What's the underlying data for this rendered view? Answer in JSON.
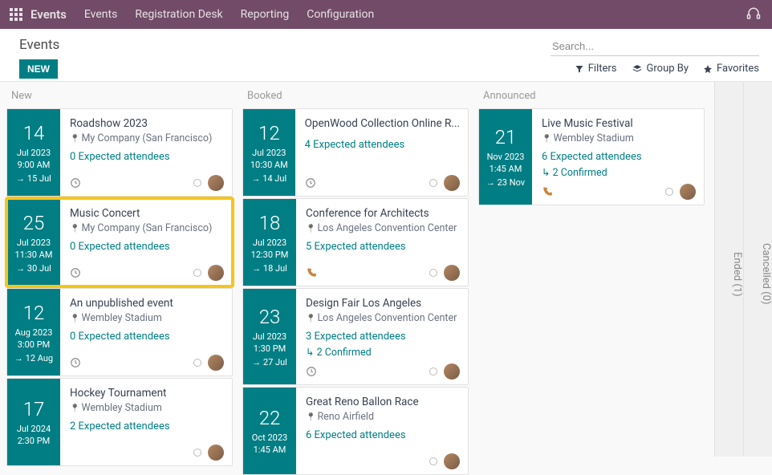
{
  "topbar": {
    "brand": "Events",
    "menu": [
      "Events",
      "Registration Desk",
      "Reporting",
      "Configuration"
    ]
  },
  "page": {
    "title": "Events",
    "new_btn": "NEW",
    "search_placeholder": "Search..."
  },
  "toolbar": {
    "filters": "Filters",
    "groupby": "Group By",
    "favorites": "Favorites"
  },
  "lanes": [
    {
      "name": "New",
      "cards": [
        {
          "day": "14",
          "mon": "Jul 2023",
          "time": "9:00 AM",
          "end": "15 Jul",
          "title": "Roadshow 2023",
          "loc": "My Company (San Francisco)",
          "attendees": "0 Expected attendees",
          "foot_icon": "clock"
        },
        {
          "day": "25",
          "mon": "Jul 2023",
          "time": "11:30 AM",
          "end": "30 Jul",
          "title": "Music Concert",
          "loc": "My Company (San Francisco)",
          "attendees": "0 Expected attendees",
          "foot_icon": "clock",
          "selected": true
        },
        {
          "day": "12",
          "mon": "Aug 2023",
          "time": "3:00 PM",
          "end": "12 Aug",
          "title": "An unpublished event",
          "loc": "Wembley Stadium",
          "attendees": "0 Expected attendees",
          "foot_icon": "clock"
        },
        {
          "day": "17",
          "mon": "Jul 2024",
          "time": "2:30 PM",
          "end": "",
          "title": "Hockey Tournament",
          "loc": "Wembley Stadium",
          "attendees": "2 Expected attendees",
          "foot_icon": ""
        }
      ]
    },
    {
      "name": "Booked",
      "cards": [
        {
          "day": "12",
          "mon": "Jul 2023",
          "time": "10:30 AM",
          "end": "14 Jul",
          "title": "OpenWood Collection Online R...",
          "loc": "",
          "attendees": "4 Expected attendees",
          "foot_icon": "clock"
        },
        {
          "day": "18",
          "mon": "Jul 2023",
          "time": "12:30 PM",
          "end": "18 Jul",
          "title": "Conference for Architects",
          "loc": "Los Angeles Convention Center",
          "attendees": "5 Expected attendees",
          "foot_icon": "phone"
        },
        {
          "day": "23",
          "mon": "Jul 2023",
          "time": "1:30 PM",
          "end": "27 Jul",
          "title": "Design Fair Los Angeles",
          "loc": "Los Angeles Convention Center",
          "attendees": "3 Expected attendees",
          "confirmed": "2 Confirmed",
          "foot_icon": "clock"
        },
        {
          "day": "22",
          "mon": "Oct 2023",
          "time": "1:45 AM",
          "end": "",
          "title": "Great Reno Ballon Race",
          "loc": "Reno Airfield",
          "attendees": "6 Expected attendees",
          "foot_icon": ""
        }
      ]
    },
    {
      "name": "Announced",
      "cards": [
        {
          "day": "21",
          "mon": "Nov 2023",
          "time": "1:45 AM",
          "end": "23 Nov",
          "title": "Live Music Festival",
          "loc": "Wembley Stadium",
          "attendees": "6 Expected attendees",
          "confirmed": "2 Confirmed",
          "foot_icon": "phone"
        }
      ]
    }
  ],
  "collapsed": [
    {
      "label": "Ended (1)"
    },
    {
      "label": "Cancelled (0)"
    }
  ]
}
